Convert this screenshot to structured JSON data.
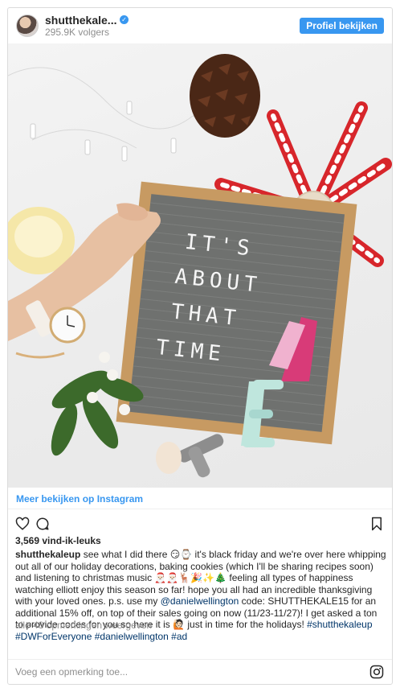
{
  "header": {
    "username": "shutthekale...",
    "followers": "295.9K volgers",
    "view_profile_label": "Profiel bekijken"
  },
  "photo": {
    "letterboard_lines": [
      "IT'S",
      "ABOUT",
      "THAT",
      "TIME"
    ]
  },
  "view_more": {
    "label": "Meer bekijken op Instagram"
  },
  "likes": "3,569 vind-ik-leuks",
  "caption": {
    "username": "shutthekaleup",
    "text_1": " see what I did there 😏⌚ it's black friday and we're over here whipping out all of our holiday decorations, baking cookies (which I'll be sharing recipes soon) and listening to christmas music 🎅🏻🎅🏻🦌🎉✨🎄 feeling all types of happiness watching elliott enjoy this season so far! hope you all had an incredible thanksgiving with your loved ones. p.s. use my ",
    "mention": "@danielwellington",
    "text_2": " code: SHUTTHEKALE15 for an additional 15% off, on top of their sales going on now (11/23-11/27)! I get asked a ton to provide codes for you so here it is 🙋🏻 just in time for the holidays!",
    "hashtags": [
      "#shutthekaleup",
      "#DWForEveryone",
      "#danielwellington",
      "#ad"
    ]
  },
  "comments_link": "alle 48 opmerkingen weergeven",
  "comment_input": {
    "placeholder": "Voeg een opmerking toe..."
  },
  "icons": {
    "verified": "verified-badge-icon",
    "like": "heart-icon",
    "comment": "comment-bubble-icon",
    "save": "bookmark-icon",
    "brand": "instagram-icon"
  },
  "colors": {
    "accent": "#3897f0",
    "text": "#262626",
    "muted": "#8e8e8e",
    "hashtag": "#003569"
  }
}
